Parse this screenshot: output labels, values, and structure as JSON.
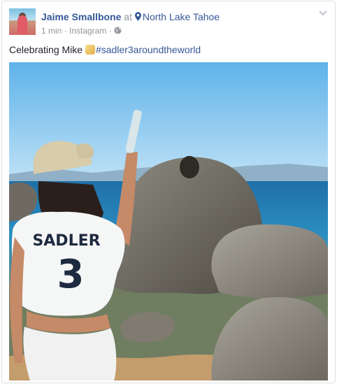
{
  "post": {
    "author": "Jaime Smallbone",
    "at_text": "at",
    "location": "North Lake Tahoe",
    "time": "1 min",
    "source": "Instagram",
    "caption_text": "Celebrating Mike",
    "hashtag": "#sadler3aroundtheworld",
    "jersey_name": "SADLER",
    "jersey_number": "3"
  },
  "icons": {
    "location": "map-pin-icon",
    "privacy": "globe-icon",
    "options": "chevron-down-icon",
    "emoji": "beer-mugs-emoji"
  },
  "colors": {
    "link": "#365899",
    "meta": "#90949c",
    "text": "#1d2129",
    "border": "#dddfe2"
  }
}
